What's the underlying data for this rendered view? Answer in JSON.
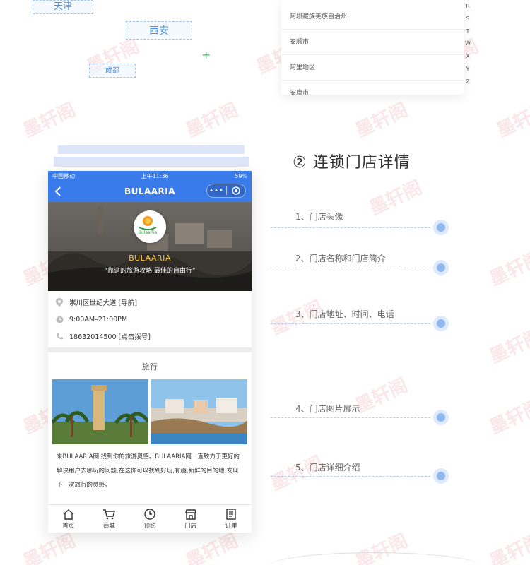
{
  "watermark_text": "墨轩阁",
  "cities": [
    "天津",
    "西安",
    "成都"
  ],
  "city_list": [
    "阿坝藏族羌族自治州",
    "安顺市",
    "阿里地区",
    "安康市"
  ],
  "alphabet": [
    "R",
    "S",
    "T",
    "W",
    "X",
    "Y",
    "Z"
  ],
  "phone": {
    "status": {
      "carrier": "中国移动",
      "time": "上午11:36",
      "battery": "59%"
    },
    "nav": {
      "title": "BULAARIA",
      "more": "•••"
    },
    "hero": {
      "logo_text": "BulaaRia",
      "brand": "BULAARIA",
      "slogan": "“靠谱的旅游攻略,最佳的自由行”"
    },
    "info": {
      "address": "崇川区世纪大道 [导航]",
      "hours": "9:00AM–21:00PM",
      "phone": "18632014500 [点击拨号]"
    },
    "section": {
      "title": "旅行",
      "description": "来BULAARIA网,找到你的旅游灵感。BULAARIA网一直致力于更好的解决用户去哪玩的问题,在这你可以找到好玩,有趣,新鲜的目的地,发现下一次旅行的灵感。"
    },
    "tabs": [
      "首页",
      "商城",
      "预约",
      "门店",
      "订单"
    ]
  },
  "right": {
    "title": "② 连锁门店详情",
    "items": [
      "1、门店头像",
      "2、门店名称和门店简介",
      "3、门店地址、时间、电话",
      "4、门店图片展示",
      "5、门店详细介绍"
    ]
  },
  "colors": {
    "primary": "#3a7bec",
    "brand_gold": "#f5c842",
    "accent_dot": "#8fb7f0"
  }
}
